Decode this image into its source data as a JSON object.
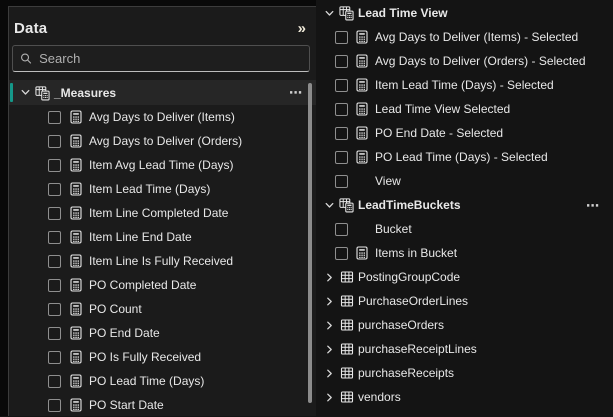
{
  "colors": {
    "accent_teal": "#159889",
    "pane_bg": "#1b1b1b",
    "selected_row_bg": "#262626",
    "text": "#e8e8e8",
    "placeholder": "#b0b0b0",
    "scrollbar": "#8c8c8c"
  },
  "icons": {
    "collapse_pane": "»",
    "more_options": "⋯"
  },
  "pane": {
    "title": "Data",
    "search_placeholder": "Search"
  },
  "measures_group": {
    "label": "_Measures",
    "selected": true
  },
  "measures": [
    {
      "label": "Avg Days to Deliver (Items)"
    },
    {
      "label": "Avg Days to Deliver (Orders)"
    },
    {
      "label": "Item Avg Lead Time (Days)"
    },
    {
      "label": "Item Lead Time (Days)"
    },
    {
      "label": "Item Line Completed Date"
    },
    {
      "label": "Item Line End Date"
    },
    {
      "label": "Item Line Is Fully Received"
    },
    {
      "label": "PO Completed Date"
    },
    {
      "label": "PO Count"
    },
    {
      "label": "PO End Date"
    },
    {
      "label": "PO Is Fully Received"
    },
    {
      "label": "PO Lead Time (Days)"
    },
    {
      "label": "PO Start Date"
    }
  ],
  "field_list": {
    "groups": [
      {
        "label": "Lead Time View",
        "expanded": true,
        "items": [
          {
            "label": "Avg Days to Deliver (Items) - Selected",
            "measure": true
          },
          {
            "label": "Avg Days to Deliver (Orders) - Selected",
            "measure": true
          },
          {
            "label": "Item Lead Time (Days) - Selected",
            "measure": true
          },
          {
            "label": "Lead Time View Selected",
            "measure": true
          },
          {
            "label": "PO End Date - Selected",
            "measure": true
          },
          {
            "label": "PO Lead Time (Days) - Selected",
            "measure": true
          },
          {
            "label": "View",
            "measure": false
          }
        ]
      },
      {
        "label": "LeadTimeBuckets",
        "expanded": true,
        "has_more": true,
        "items": [
          {
            "label": "Bucket",
            "measure": false
          },
          {
            "label": "Items in Bucket",
            "measure": true
          }
        ]
      }
    ],
    "tables": [
      {
        "label": "PostingGroupCode"
      },
      {
        "label": "PurchaseOrderLines"
      },
      {
        "label": "purchaseOrders"
      },
      {
        "label": "purchaseReceiptLines"
      },
      {
        "label": "purchaseReceipts"
      },
      {
        "label": "vendors"
      }
    ]
  }
}
